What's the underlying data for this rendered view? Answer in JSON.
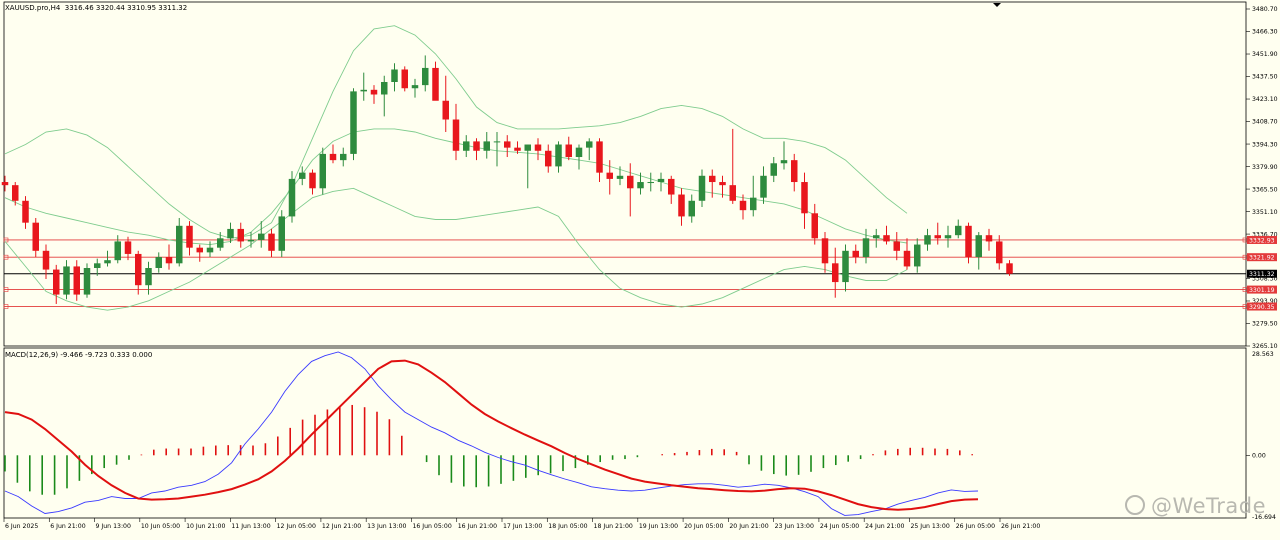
{
  "header": {
    "symbol_title": "XAUUSD.pro,H4",
    "ohlc": "3316.46 3320.44 3310.95 3311.32"
  },
  "macd_panel": {
    "title": "MACD(12,26,9) -9.466 -9.723 0.333 0.000"
  },
  "watermark": "@WeTrade",
  "colors": {
    "background": "#fffff0",
    "bull_candle": "#2e8b3e",
    "bear_candle": "#e8171d",
    "bollinger": "#7fcc8e",
    "horizontal_levels": "#e33a3a",
    "macd_main": "#3a3aff",
    "macd_signal": "#e01010",
    "histogram_positive": "#e01010",
    "histogram_negative": "#1a8a1a"
  },
  "chart_data": [
    {
      "type": "candlestick",
      "symbol": "XAUUSD.pro",
      "timeframe": "H4",
      "ylim": [
        3265.1,
        3480.7
      ],
      "y_ticks": [
        "3480.70",
        "3466.30",
        "3451.90",
        "3437.50",
        "3423.10",
        "3408.70",
        "3394.30",
        "3379.90",
        "3365.50",
        "3351.10",
        "3336.70",
        "3308.30",
        "3293.90",
        "3279.50",
        "3265.10"
      ],
      "x_ticks": [
        "6 Jun 2025",
        "6 Jun 21:00",
        "9 Jun 13:00",
        "10 Jun 05:00",
        "10 Jun 21:00",
        "11 Jun 13:00",
        "12 Jun 05:00",
        "12 Jun 21:00",
        "13 Jun 13:00",
        "16 Jun 05:00",
        "16 Jun 21:00",
        "17 Jun 13:00",
        "18 Jun 05:00",
        "18 Jun 21:00",
        "19 Jun 13:00",
        "20 Jun 05:00",
        "20 Jun 21:00",
        "23 Jun 13:00",
        "24 Jun 05:00",
        "24 Jun 21:00",
        "25 Jun 13:00",
        "26 Jun 05:00",
        "26 Jun 21:00"
      ],
      "levels": [
        {
          "label": "3332.93",
          "value": 3332.93
        },
        {
          "label": "3321.92",
          "value": 3321.92
        },
        {
          "label": "3301.19",
          "value": 3301.19
        },
        {
          "label": "3290.35",
          "value": 3290.35
        }
      ],
      "current_price": {
        "label": "3311.32",
        "value": 3311.32
      },
      "candles": [
        [
          3370,
          3374,
          3364,
          3368
        ],
        [
          3368,
          3370,
          3355,
          3358
        ],
        [
          3358,
          3361,
          3340,
          3344
        ],
        [
          3344,
          3347,
          3322,
          3326
        ],
        [
          3326,
          3330,
          3308,
          3314
        ],
        [
          3314,
          3317,
          3292,
          3298
        ],
        [
          3298,
          3320,
          3295,
          3316
        ],
        [
          3316,
          3320,
          3294,
          3298
        ],
        [
          3298,
          3318,
          3296,
          3315
        ],
        [
          3315,
          3321,
          3310,
          3318
        ],
        [
          3318,
          3326,
          3316,
          3320
        ],
        [
          3320,
          3336,
          3318,
          3332
        ],
        [
          3332,
          3335,
          3320,
          3324
        ],
        [
          3324,
          3326,
          3298,
          3304
        ],
        [
          3304,
          3319,
          3298,
          3315
        ],
        [
          3315,
          3325,
          3312,
          3322
        ],
        [
          3322,
          3330,
          3314,
          3318
        ],
        [
          3318,
          3347,
          3316,
          3342
        ],
        [
          3342,
          3345,
          3323,
          3328
        ],
        [
          3328,
          3330,
          3319,
          3325
        ],
        [
          3325,
          3332,
          3322,
          3328
        ],
        [
          3328,
          3338,
          3326,
          3334
        ],
        [
          3334,
          3344,
          3331,
          3340
        ],
        [
          3340,
          3344,
          3328,
          3332
        ],
        [
          3332,
          3338,
          3328,
          3333
        ],
        [
          3333,
          3345,
          3328,
          3337
        ],
        [
          3337,
          3340,
          3322,
          3326
        ],
        [
          3326,
          3352,
          3322,
          3348
        ],
        [
          3348,
          3377,
          3344,
          3372
        ],
        [
          3372,
          3380,
          3368,
          3376
        ],
        [
          3376,
          3378,
          3362,
          3366
        ],
        [
          3366,
          3392,
          3362,
          3388
        ],
        [
          3388,
          3394,
          3382,
          3384
        ],
        [
          3384,
          3392,
          3380,
          3388
        ],
        [
          3388,
          3430,
          3384,
          3428
        ],
        [
          3428,
          3440,
          3422,
          3429
        ],
        [
          3429,
          3432,
          3420,
          3426
        ],
        [
          3426,
          3438,
          3412,
          3434
        ],
        [
          3434,
          3446,
          3428,
          3442
        ],
        [
          3442,
          3444,
          3428,
          3430
        ],
        [
          3430,
          3436,
          3424,
          3432
        ],
        [
          3432,
          3451,
          3428,
          3443
        ],
        [
          3443,
          3447,
          3430,
          3422
        ],
        [
          3422,
          3438,
          3402,
          3410
        ],
        [
          3410,
          3420,
          3384,
          3390
        ],
        [
          3390,
          3400,
          3386,
          3396
        ],
        [
          3396,
          3398,
          3384,
          3390
        ],
        [
          3390,
          3402,
          3385,
          3396
        ],
        [
          3396,
          3402,
          3380,
          3396
        ],
        [
          3396,
          3400,
          3386,
          3392
        ],
        [
          3392,
          3396,
          3388,
          3390
        ],
        [
          3390,
          3394,
          3366,
          3394
        ],
        [
          3394,
          3398,
          3384,
          3390
        ],
        [
          3390,
          3394,
          3376,
          3380
        ],
        [
          3380,
          3396,
          3376,
          3394
        ],
        [
          3394,
          3399,
          3384,
          3386
        ],
        [
          3386,
          3394,
          3378,
          3392
        ],
        [
          3392,
          3398,
          3384,
          3396
        ],
        [
          3396,
          3398,
          3370,
          3376
        ],
        [
          3376,
          3384,
          3362,
          3372
        ],
        [
          3372,
          3380,
          3368,
          3374
        ],
        [
          3374,
          3382,
          3348,
          3366
        ],
        [
          3366,
          3376,
          3362,
          3370
        ],
        [
          3370,
          3376,
          3364,
          3370
        ],
        [
          3370,
          3376,
          3364,
          3372
        ],
        [
          3372,
          3374,
          3356,
          3362
        ],
        [
          3362,
          3366,
          3342,
          3348
        ],
        [
          3348,
          3362,
          3344,
          3358
        ],
        [
          3358,
          3378,
          3354,
          3374
        ],
        [
          3374,
          3378,
          3360,
          3370
        ],
        [
          3370,
          3374,
          3360,
          3368
        ],
        [
          3368,
          3404,
          3356,
          3358
        ],
        [
          3358,
          3362,
          3346,
          3352
        ],
        [
          3352,
          3374,
          3348,
          3360
        ],
        [
          3360,
          3380,
          3356,
          3374
        ],
        [
          3374,
          3386,
          3370,
          3382
        ],
        [
          3382,
          3396,
          3378,
          3384
        ],
        [
          3384,
          3388,
          3364,
          3370
        ],
        [
          3370,
          3376,
          3340,
          3350
        ],
        [
          3350,
          3356,
          3330,
          3334
        ],
        [
          3334,
          3338,
          3312,
          3318
        ],
        [
          3318,
          3328,
          3296,
          3306
        ],
        [
          3306,
          3330,
          3300,
          3326
        ],
        [
          3326,
          3330,
          3318,
          3322
        ],
        [
          3322,
          3340,
          3318,
          3334
        ],
        [
          3334,
          3340,
          3328,
          3336
        ],
        [
          3336,
          3342,
          3330,
          3332
        ],
        [
          3332,
          3338,
          3320,
          3326
        ],
        [
          3326,
          3334,
          3314,
          3316
        ],
        [
          3316,
          3334,
          3312,
          3330
        ],
        [
          3330,
          3340,
          3326,
          3336
        ],
        [
          3336,
          3344,
          3330,
          3334
        ],
        [
          3334,
          3342,
          3328,
          3336
        ],
        [
          3336,
          3346,
          3334,
          3342
        ],
        [
          3342,
          3344,
          3318,
          3322
        ],
        [
          3322,
          3338,
          3314,
          3336
        ],
        [
          3336,
          3340,
          3326,
          3332
        ],
        [
          3332,
          3336,
          3314,
          3318
        ],
        [
          3318,
          3320,
          3310,
          3311.32
        ]
      ],
      "bollinger": {
        "upper": [
          3388,
          3394,
          3402,
          3404,
          3400,
          3392,
          3380,
          3368,
          3356,
          3346,
          3338,
          3334,
          3336,
          3344,
          3368,
          3398,
          3428,
          3454,
          3468,
          3470,
          3464,
          3452,
          3436,
          3418,
          3408,
          3404,
          3404,
          3404,
          3405,
          3406,
          3408,
          3412,
          3417,
          3419,
          3417,
          3412,
          3404,
          3398,
          3398,
          3396,
          3392,
          3384,
          3372,
          3360,
          3350
        ],
        "middle": [
          3360,
          3354,
          3350,
          3347,
          3344,
          3341,
          3338,
          3336,
          3333,
          3331,
          3330,
          3332,
          3338,
          3350,
          3366,
          3384,
          3396,
          3402,
          3404,
          3404,
          3402,
          3398,
          3395,
          3392,
          3390,
          3389,
          3388,
          3386,
          3384,
          3382,
          3378,
          3374,
          3370,
          3366,
          3364,
          3362,
          3360,
          3358,
          3356,
          3352,
          3346,
          3340,
          3336,
          3333,
          3331
        ],
        "lower": [
          3332,
          3316,
          3300,
          3294,
          3290,
          3288,
          3290,
          3294,
          3300,
          3306,
          3314,
          3322,
          3330,
          3340,
          3350,
          3360,
          3364,
          3366,
          3360,
          3354,
          3348,
          3346,
          3346,
          3348,
          3350,
          3352,
          3354,
          3348,
          3330,
          3314,
          3302,
          3296,
          3292,
          3290,
          3292,
          3296,
          3302,
          3308,
          3314,
          3316,
          3314,
          3310,
          3307,
          3307,
          3314
        ]
      }
    },
    {
      "type": "macd",
      "title": "MACD(12,26,9) -9.466 -9.723 0.333 0.000",
      "ylim": [
        -16.694,
        28.563
      ],
      "y_ticks": [
        "28.563",
        "0.00",
        "-16.694"
      ],
      "main": [
        -9.5,
        -11,
        -13.5,
        -15.5,
        -15,
        -14,
        -12.5,
        -12,
        -11,
        -11.5,
        -11.5,
        -10,
        -9.5,
        -8.5,
        -8,
        -7,
        -5,
        -2,
        3,
        7,
        11.5,
        17,
        21.5,
        25,
        26.5,
        27.5,
        26,
        23,
        18.5,
        14.8,
        11.5,
        9.5,
        7.5,
        6,
        4,
        2.5,
        0.8,
        -0.6,
        -1.7,
        -2.6,
        -4,
        -5.2,
        -6.3,
        -7.3,
        -8.4,
        -8.9,
        -9.3,
        -9.5,
        -9.3,
        -8.7,
        -8.2,
        -7.8,
        -7.6,
        -7.6,
        -8,
        -8.5,
        -8.2,
        -7.7,
        -8,
        -8.7,
        -9.7,
        -11,
        -14.2,
        -16,
        -15.8,
        -15,
        -14.3,
        -13,
        -12,
        -11.2,
        -10,
        -9.2,
        -9.6,
        -9.5
      ],
      "signal": [
        11.5,
        11,
        9.5,
        7,
        4,
        1,
        -2.5,
        -5.5,
        -8,
        -10,
        -11.5,
        -11.8,
        -11.7,
        -11.5,
        -11,
        -10.5,
        -9.8,
        -9,
        -7.8,
        -6.4,
        -4.3,
        -1.5,
        1.8,
        5.5,
        9,
        12.5,
        16,
        19.5,
        23,
        25,
        25.2,
        24.2,
        22,
        19.5,
        16.5,
        13.5,
        11,
        9,
        7.2,
        5.5,
        3.9,
        2.4,
        0.6,
        -1,
        -2.4,
        -3.8,
        -5,
        -6.2,
        -7,
        -7.5,
        -8,
        -8.4,
        -8.8,
        -9,
        -9.3,
        -9.5,
        -9.6,
        -9.4,
        -9,
        -8.8,
        -8.9,
        -9.6,
        -10.6,
        -11.8,
        -13,
        -13.8,
        -14.3,
        -14.5,
        -14.3,
        -13.8,
        -13,
        -12.2,
        -11.8,
        -11.7
      ],
      "histogram": [
        -4.3,
        -7.3,
        -9.6,
        -10.5,
        -10.5,
        -8.8,
        -6.8,
        -5,
        -3.4,
        -2.5,
        -1.2,
        0.2,
        1.5,
        1.8,
        1.8,
        1.8,
        2.3,
        2.6,
        2.7,
        2.7,
        2.6,
        3.2,
        5,
        7.3,
        9.5,
        10.8,
        12.2,
        13.1,
        13.4,
        12.8,
        11.6,
        9.6,
        5.2,
        0,
        -1.8,
        -5.3,
        -7.3,
        -8.3,
        -8.5,
        -8.3,
        -7.6,
        -6.8,
        -6,
        -5.3,
        -4.8,
        -4.2,
        -3.4,
        -2.5,
        -1.8,
        -1.2,
        -1,
        -0.5,
        0,
        0.3,
        0.6,
        0.9,
        1.4,
        1.7,
        1.6,
        0.9,
        -2.4,
        -4.1,
        -5,
        -5.4,
        -5.2,
        -4.4,
        -3.4,
        -2.6,
        -1.7,
        -1,
        0.3,
        1.3,
        1.7,
        2,
        2,
        1.8,
        1.7,
        1.3,
        0.3
      ]
    }
  ]
}
